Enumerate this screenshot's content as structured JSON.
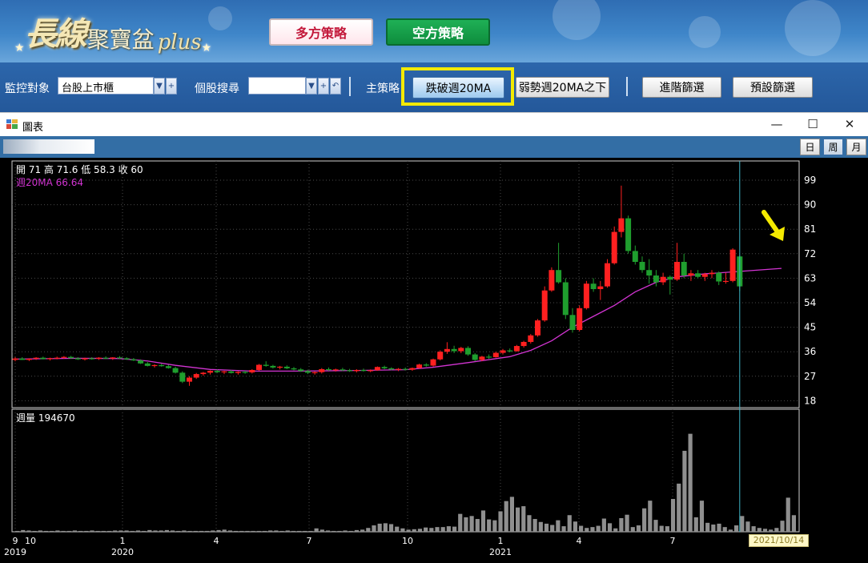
{
  "banner": {
    "logo_main": "長線",
    "logo_mid": "聚寶盆",
    "logo_plus": "plus",
    "long_strategy_label": "多方策略",
    "short_strategy_label": "空方策略"
  },
  "toolbar": {
    "monitor_label": "監控對象",
    "monitor_value": "台股上市櫃",
    "search_label": "個股搜尋",
    "search_value": "",
    "main_strategy_label": "主策略",
    "strategy_primary": "跌破週20MA",
    "strategy_secondary": "弱勢週20MA之下",
    "advanced_filter": "進階篩選",
    "default_filter": "預設篩選",
    "colors": {
      "highlight": "#f4ea00",
      "bg": "#2c66ab"
    }
  },
  "window": {
    "title": "圖表",
    "minimize": "—",
    "maximize": "☐",
    "close": "✕",
    "period_buttons": [
      "日",
      "周",
      "月"
    ],
    "selected_period": "周"
  },
  "price_panel": {
    "ohlc_text": "開 71  高 71.6  低 58.3  收 60",
    "ma_text": "週20MA 66.64",
    "yticks": [
      99,
      90,
      81,
      72,
      63,
      54,
      45,
      36,
      27,
      18
    ],
    "up_color": "#ff2020",
    "down_color": "#1f9e2e",
    "ma_color": "#d234d2"
  },
  "volume_panel": {
    "label": "週量 194670"
  },
  "time_axis": {
    "labels": [
      {
        "m": "9",
        "y": "2019"
      },
      {
        "m": "10",
        "y": ""
      },
      {
        "m": "1",
        "y": "2020"
      },
      {
        "m": "4",
        "y": ""
      },
      {
        "m": "7",
        "y": ""
      },
      {
        "m": "10",
        "y": ""
      },
      {
        "m": "1",
        "y": "2021"
      },
      {
        "m": "4",
        "y": ""
      },
      {
        "m": "7",
        "y": ""
      }
    ],
    "cursor_date": "2021/10/14"
  },
  "chart_data": {
    "type": "candlestick",
    "weeks": 111,
    "ylim": [
      18,
      99
    ],
    "candles": [
      [
        33,
        34,
        32.5,
        33.5
      ],
      [
        33.5,
        34,
        33,
        33
      ],
      [
        33,
        33.6,
        32.6,
        33.4
      ],
      [
        33.4,
        34,
        33,
        33.8
      ],
      [
        33.8,
        34.2,
        33.2,
        33.3
      ],
      [
        33.3,
        33.8,
        32.8,
        33.6
      ],
      [
        33.6,
        34.2,
        33.2,
        33.8
      ],
      [
        33.8,
        34.4,
        33.4,
        34.1
      ],
      [
        34.1,
        34.5,
        33.5,
        33.6
      ],
      [
        33.6,
        34,
        33,
        33.2
      ],
      [
        33.2,
        33.8,
        32.8,
        33.6
      ],
      [
        33.6,
        34,
        33.1,
        33.4
      ],
      [
        33.4,
        34,
        33,
        33.8
      ],
      [
        33.8,
        34.3,
        33.3,
        33.5
      ],
      [
        33.5,
        34,
        33,
        33.9
      ],
      [
        33.9,
        34.4,
        33.4,
        33.6
      ],
      [
        33.6,
        34,
        33,
        33.2
      ],
      [
        33.2,
        33.7,
        32.6,
        32.8
      ],
      [
        32.8,
        33.2,
        31.5,
        31.7
      ],
      [
        31.7,
        32.2,
        30.6,
        30.8
      ],
      [
        30.8,
        31.4,
        30.2,
        31.1
      ],
      [
        31.1,
        31.6,
        30.5,
        30.7
      ],
      [
        30.7,
        31.2,
        29.8,
        30
      ],
      [
        30,
        30.5,
        28,
        28.3
      ],
      [
        28.3,
        28.8,
        24.5,
        25
      ],
      [
        25,
        27,
        23.5,
        26.5
      ],
      [
        26.5,
        28.2,
        26,
        27.8
      ],
      [
        27.8,
        28.6,
        27.2,
        28.3
      ],
      [
        28.3,
        29.2,
        27.6,
        29
      ],
      [
        29,
        29.5,
        28.2,
        28.5
      ],
      [
        28.5,
        29,
        27.8,
        28.8
      ],
      [
        28.8,
        29.3,
        28,
        28.2
      ],
      [
        28.2,
        28.8,
        27.6,
        28.6
      ],
      [
        28.6,
        29,
        27.9,
        28.4
      ],
      [
        28.4,
        29.6,
        28,
        29.3
      ],
      [
        29.3,
        31.5,
        29,
        31.2
      ],
      [
        31.2,
        32.5,
        30.5,
        30.8
      ],
      [
        30.8,
        31.2,
        29.8,
        30.2
      ],
      [
        30.2,
        30.8,
        29.5,
        30.5
      ],
      [
        30.5,
        31,
        29.6,
        29.9
      ],
      [
        29.9,
        30.4,
        29.2,
        29.5
      ],
      [
        29.5,
        30,
        28.6,
        28.9
      ],
      [
        28.9,
        29.4,
        27.8,
        28.3
      ],
      [
        28.3,
        28.8,
        27.6,
        28.5
      ],
      [
        28.5,
        30,
        28,
        29.6
      ],
      [
        29.6,
        30.2,
        29,
        29.3
      ],
      [
        29.3,
        29.8,
        28.7,
        29.5
      ],
      [
        29.5,
        30.1,
        28.9,
        29.2
      ],
      [
        29.2,
        29.7,
        28.6,
        28.9
      ],
      [
        28.9,
        29.6,
        28.4,
        29.3
      ],
      [
        29.3,
        29.8,
        28.7,
        29
      ],
      [
        29,
        29.5,
        28.5,
        29.2
      ],
      [
        29.2,
        30.6,
        29,
        30.4
      ],
      [
        30.4,
        30.9,
        29.6,
        29.9
      ],
      [
        29.9,
        30.3,
        29.2,
        29.5
      ],
      [
        29.5,
        30,
        28.9,
        29.7
      ],
      [
        29.7,
        30.2,
        29.1,
        29.4
      ],
      [
        29.4,
        30.2,
        29,
        30
      ],
      [
        30,
        31.6,
        29.8,
        31.3
      ],
      [
        31.3,
        31.8,
        30.5,
        30.9
      ],
      [
        30.9,
        33.5,
        30.5,
        33.2
      ],
      [
        33.2,
        36.5,
        32.8,
        36
      ],
      [
        36,
        39.5,
        35.2,
        37
      ],
      [
        37,
        38.2,
        35.5,
        36.2
      ],
      [
        36.2,
        37.8,
        35.5,
        37.4
      ],
      [
        37.4,
        38,
        34.5,
        35
      ],
      [
        35,
        35.5,
        32.5,
        33
      ],
      [
        33,
        34.5,
        32.5,
        34.2
      ],
      [
        34.2,
        35,
        33.4,
        34
      ],
      [
        34,
        36,
        33.8,
        35.6
      ],
      [
        35.6,
        37,
        35,
        36.5
      ],
      [
        36.5,
        37.2,
        35.8,
        36.2
      ],
      [
        36.2,
        38.5,
        36,
        38.1
      ],
      [
        38.1,
        40,
        37.5,
        39.6
      ],
      [
        39.6,
        42.5,
        39,
        42
      ],
      [
        42,
        48,
        41.5,
        47.5
      ],
      [
        47.5,
        60,
        47,
        58.5
      ],
      [
        58.5,
        67,
        58,
        66
      ],
      [
        66,
        76,
        61,
        61.5
      ],
      [
        61.5,
        63,
        48,
        49.5
      ],
      [
        49.5,
        52,
        43,
        44
      ],
      [
        44,
        53,
        43.5,
        52
      ],
      [
        52,
        62,
        51.5,
        61
      ],
      [
        61,
        63,
        58,
        59
      ],
      [
        59,
        62,
        55,
        60
      ],
      [
        60,
        70,
        59.5,
        68.5
      ],
      [
        68.5,
        82,
        68,
        80
      ],
      [
        80,
        97,
        78,
        85
      ],
      [
        85,
        86,
        72,
        73
      ],
      [
        73,
        75,
        68,
        69
      ],
      [
        69,
        71,
        65,
        66
      ],
      [
        66,
        70,
        61,
        64
      ],
      [
        64,
        66,
        60,
        61.5
      ],
      [
        61.5,
        65,
        60.5,
        63.5
      ],
      [
        63.5,
        64,
        57,
        62.5
      ],
      [
        62.5,
        76,
        62,
        69
      ],
      [
        69,
        72,
        63,
        64
      ],
      [
        64,
        66,
        62,
        64.8
      ],
      [
        64.8,
        66,
        63,
        63.5
      ],
      [
        63.5,
        65,
        62,
        64.5
      ],
      [
        64.5,
        66,
        63,
        65
      ],
      [
        65,
        65.5,
        60.5,
        61.8
      ],
      [
        61.8,
        65,
        61,
        62
      ],
      [
        62,
        74,
        61.5,
        73.5
      ],
      [
        71,
        71.6,
        58.3,
        60
      ]
    ],
    "ma20": [
      [
        1,
        33.3
      ],
      [
        10,
        33.6
      ],
      [
        16,
        33.5
      ],
      [
        20,
        32.6
      ],
      [
        24,
        31
      ],
      [
        29,
        29.5
      ],
      [
        35,
        28.9
      ],
      [
        42,
        28.9
      ],
      [
        50,
        29.1
      ],
      [
        57,
        29.4
      ],
      [
        61,
        30.3
      ],
      [
        66,
        32
      ],
      [
        72,
        34.2
      ],
      [
        75,
        36.5
      ],
      [
        78,
        40
      ],
      [
        81,
        45
      ],
      [
        84,
        49
      ],
      [
        87,
        53
      ],
      [
        90,
        58
      ],
      [
        93,
        61.5
      ],
      [
        96,
        63.5
      ],
      [
        100,
        64.6
      ],
      [
        105,
        65.5
      ],
      [
        111,
        66.6
      ]
    ],
    "volumes": [
      1000,
      2000,
      1500,
      1000,
      1500,
      1000,
      1000,
      1500,
      1000,
      1000,
      1500,
      1000,
      1000,
      1500,
      1000,
      1000,
      1000,
      1500,
      1500,
      1500,
      1000,
      1500,
      1000,
      2000,
      1500,
      1500,
      2000,
      1500,
      1000,
      1500,
      1000,
      1000,
      1000,
      1000,
      1500,
      2000,
      2500,
      1500,
      1000,
      1000,
      1000,
      1000,
      1000,
      1000,
      1500,
      1500,
      1000,
      1500,
      1000,
      1000,
      1000,
      1000,
      4000,
      2500,
      1500,
      1000,
      1000,
      1500,
      1000,
      2000,
      2500,
      4500,
      7500,
      9500,
      10000,
      9000,
      6000,
      4000,
      2500,
      3000,
      3500,
      5000,
      4500,
      5500,
      5500,
      6500,
      6000,
      21000,
      17000,
      18500,
      15000,
      25000,
      14500,
      13500,
      24000,
      36000,
      41000,
      28500,
      30000,
      19500,
      15000,
      11500,
      9500,
      8000,
      13500,
      6500,
      19500,
      12000,
      7000,
      4500,
      5500,
      7000,
      15500,
      10000,
      4000,
      16000,
      20000,
      5500,
      7500,
      27500,
      36500,
      14000,
      7000,
      6500,
      38500,
      56500,
      95000,
      115000,
      17000,
      36500,
      10500,
      8500,
      9500,
      5500,
      2500,
      7500,
      18500,
      12000,
      6500,
      4500,
      3500,
      2500,
      4500,
      13000,
      40000,
      19467
    ],
    "vol_max": 125000
  }
}
